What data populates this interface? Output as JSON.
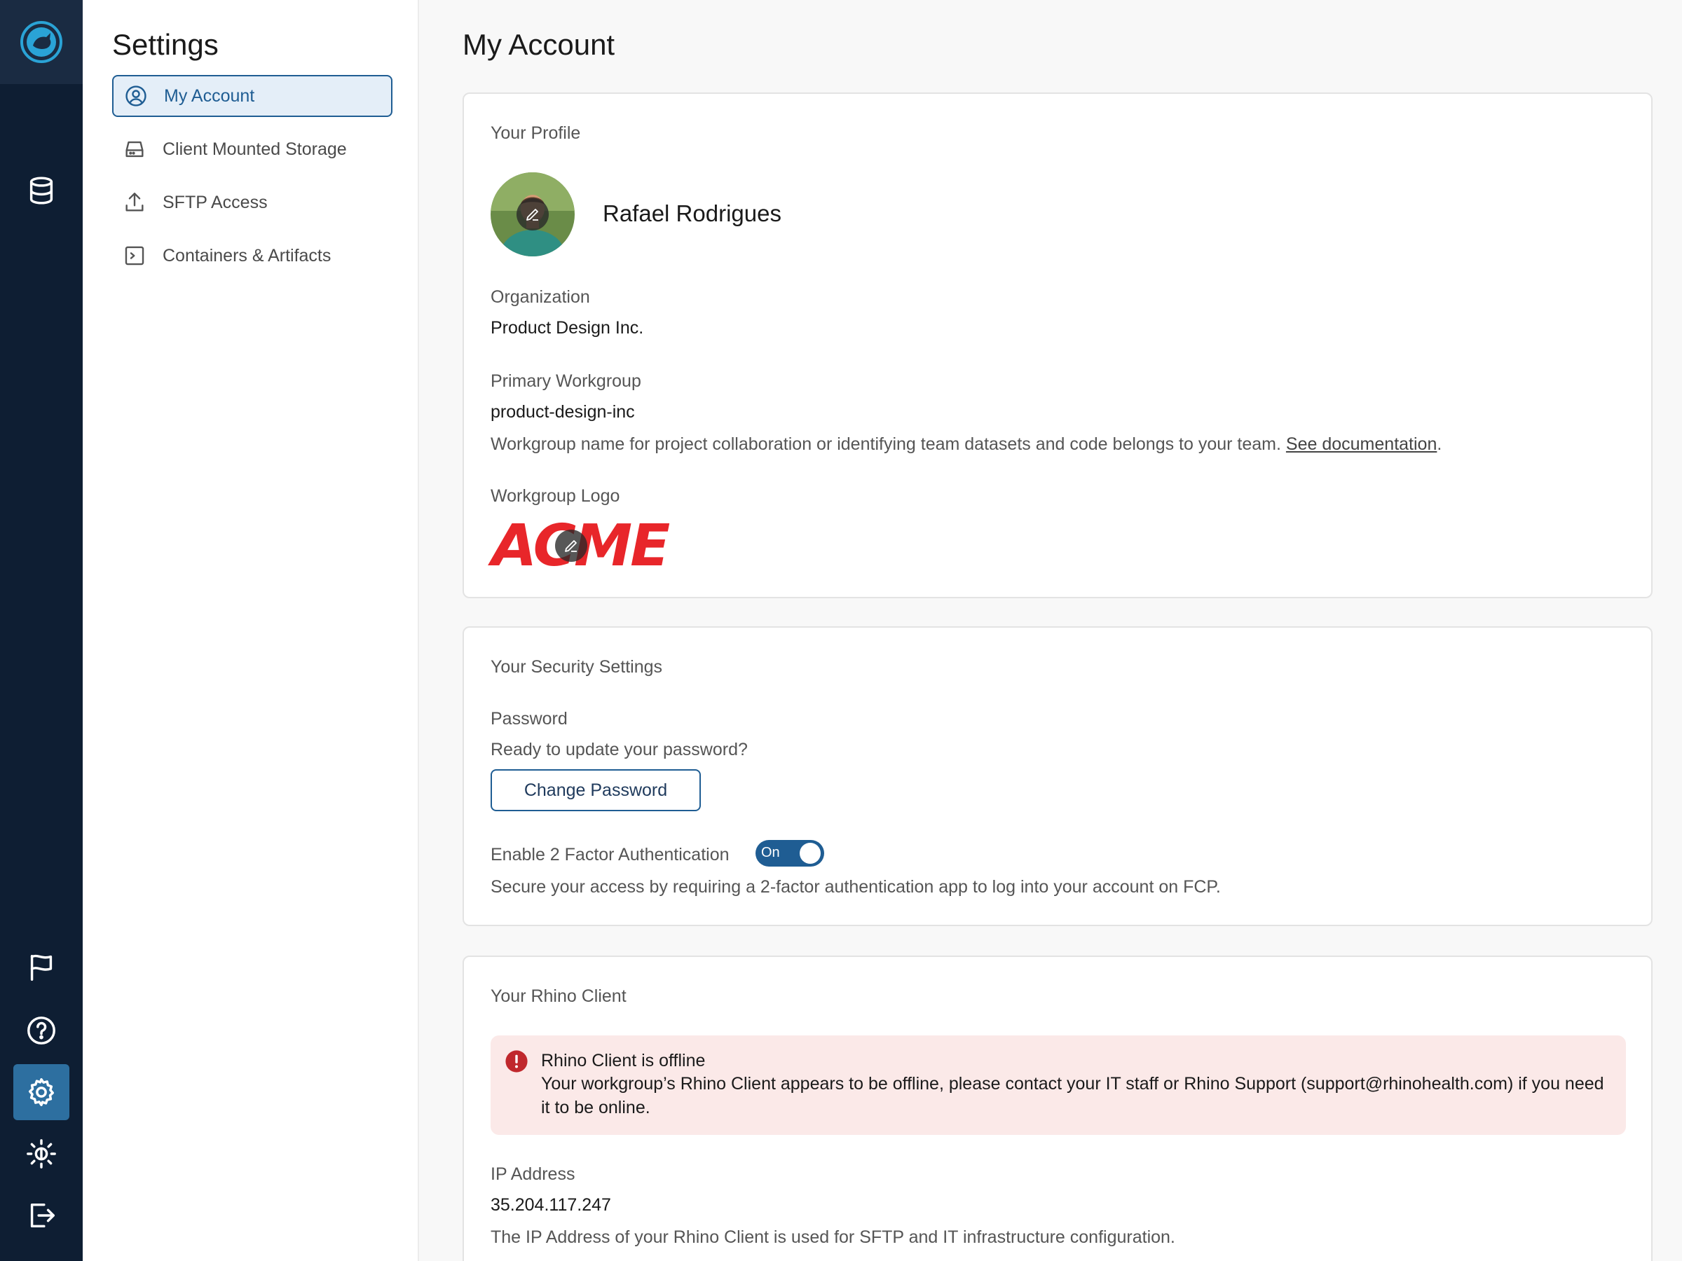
{
  "rail": {
    "icons": [
      "rhino-logo-icon",
      "database-icon",
      "flag-icon",
      "help-icon",
      "settings-icon",
      "brightness-icon",
      "logout-icon"
    ],
    "active": "settings-icon",
    "accent": "#2d6fa0"
  },
  "nav": {
    "title": "Settings",
    "items": [
      {
        "label": "My Account",
        "icon": "user-circle-icon",
        "active": true
      },
      {
        "label": "Client Mounted Storage",
        "icon": "hard-drive-icon",
        "active": false
      },
      {
        "label": "SFTP Access",
        "icon": "upload-icon",
        "active": false
      },
      {
        "label": "Containers & Artifacts",
        "icon": "terminal-icon",
        "active": false
      }
    ]
  },
  "main": {
    "title": "My Account",
    "profile": {
      "heading": "Your Profile",
      "name": "Rafael Rodrigues",
      "organization_label": "Organization",
      "organization_value": "Product Design Inc.",
      "workgroup_label": "Primary Workgroup",
      "workgroup_value": "product-design-inc",
      "workgroup_hint": "Workgroup name for project collaboration or identifying team datasets and code belongs to your team.",
      "workgroup_link": "See documentation",
      "workgroup_hint_end": ".",
      "logo_label": "Workgroup Logo",
      "logo_text": "ACME",
      "logo_color": "#e8262a"
    },
    "security": {
      "heading": "Your Security Settings",
      "password_label": "Password",
      "password_hint": "Ready to update your password?",
      "change_password_button": "Change Password",
      "twofa_label": "Enable 2 Factor Authentication",
      "twofa_toggle": "On",
      "twofa_hint": "Secure your access by requiring a 2-factor authentication app to log into your account on FCP."
    },
    "client": {
      "heading": "Your Rhino Client",
      "alert_title": "Rhino Client is offline",
      "alert_body": "Your workgroup’s Rhino Client appears to be offline, please contact your IT staff or Rhino Support (support@rhinohealth.com) if you need it to be online.",
      "alert_color": "#c0282d",
      "ip_label": "IP Address",
      "ip_value": "35.204.117.247",
      "ip_hint": "The IP Address of your Rhino Client is used for SFTP and IT infrastructure configuration."
    }
  }
}
